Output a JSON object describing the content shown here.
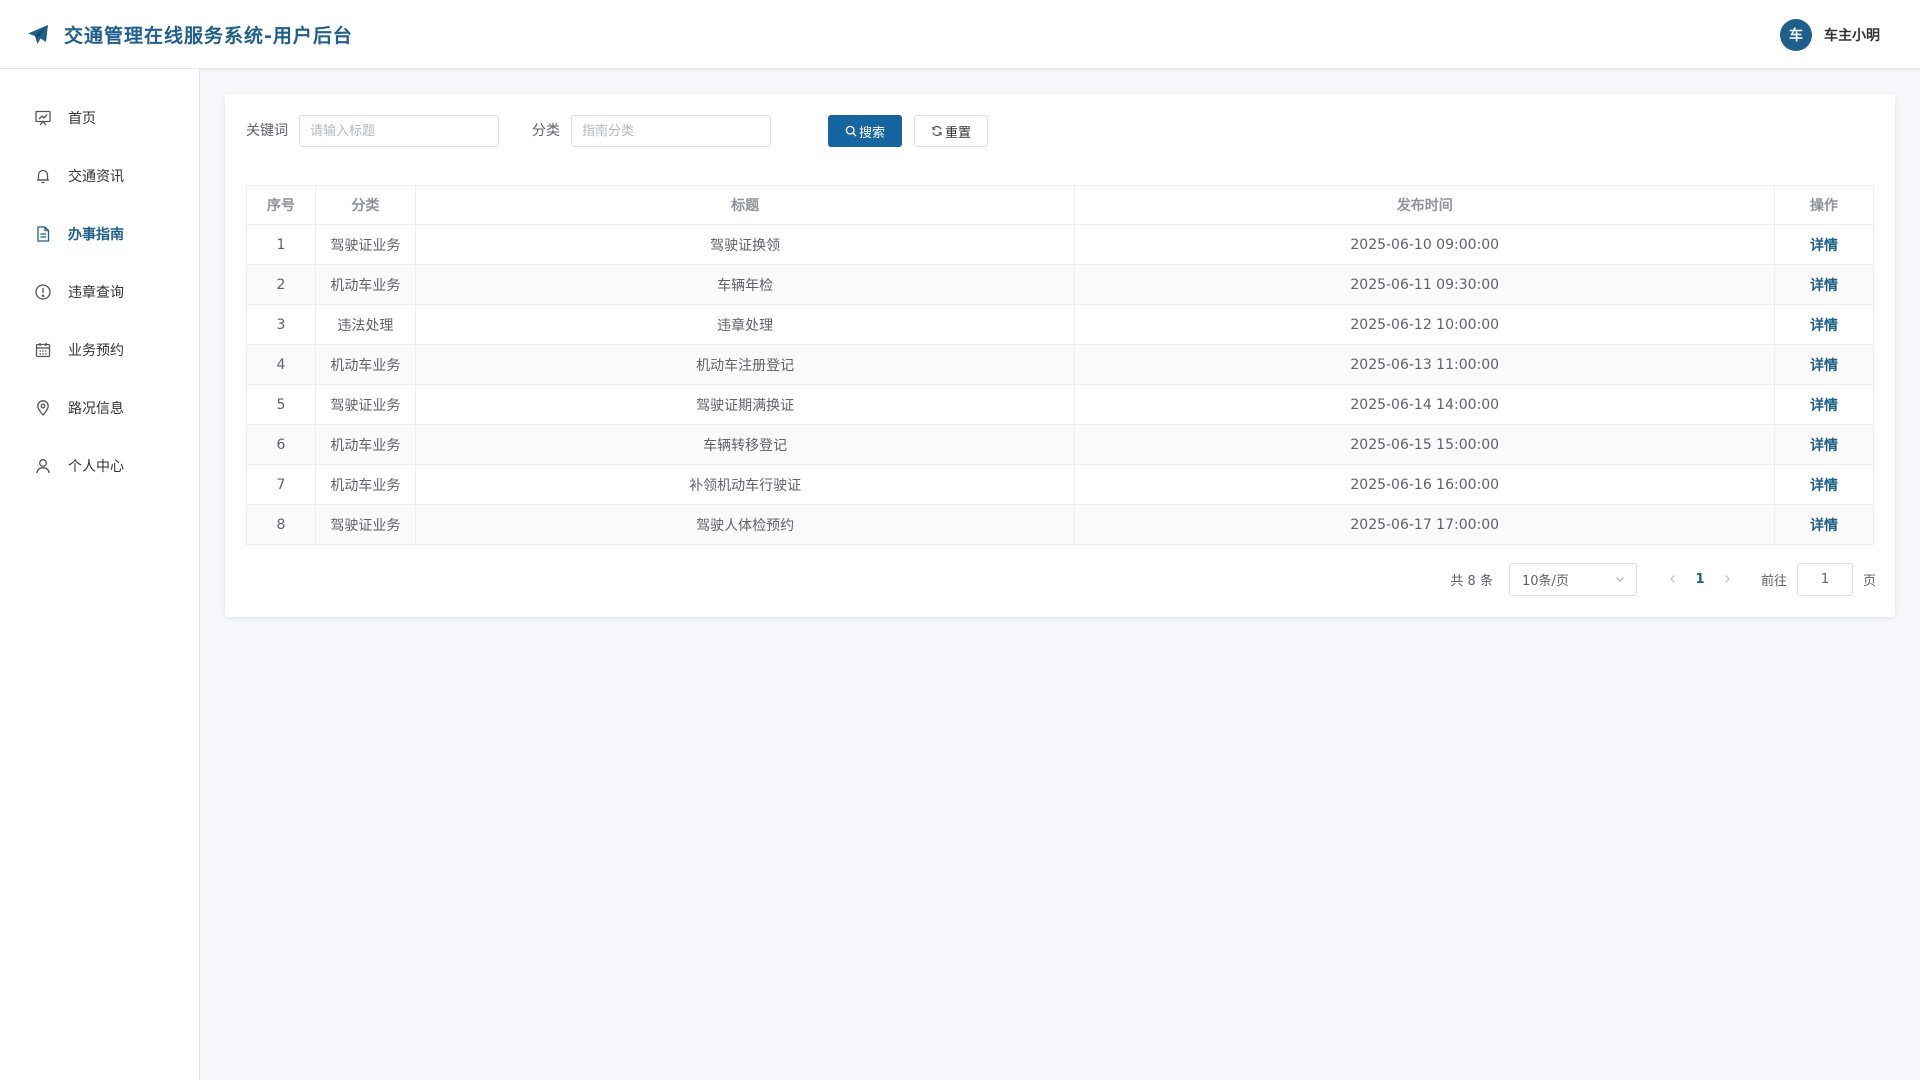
{
  "app": {
    "title": "交通管理在线服务系统-用户后台",
    "brand_color": "#1f5f8b"
  },
  "user": {
    "avatar_text": "车",
    "name": "车主小明"
  },
  "sidebar": {
    "items": [
      {
        "label": "首页",
        "icon": "dashboard-icon",
        "active": false
      },
      {
        "label": "交通资讯",
        "icon": "bell-icon",
        "active": false
      },
      {
        "label": "办事指南",
        "icon": "document-icon",
        "active": true
      },
      {
        "label": "违章查询",
        "icon": "warning-circle-icon",
        "active": false
      },
      {
        "label": "业务预约",
        "icon": "calendar-icon",
        "active": false
      },
      {
        "label": "路况信息",
        "icon": "location-pin-icon",
        "active": false
      },
      {
        "label": "个人中心",
        "icon": "user-icon",
        "active": false
      }
    ]
  },
  "filter": {
    "keyword_label": "关键词",
    "keyword_placeholder": "请输入标题",
    "keyword_value": "",
    "category_label": "分类",
    "category_placeholder": "指南分类",
    "category_value": "",
    "search_label": "搜索",
    "reset_label": "重置"
  },
  "table": {
    "headers": [
      "序号",
      "分类",
      "标题",
      "发布时间",
      "操作"
    ],
    "rows": [
      {
        "no": "1",
        "category": "驾驶证业务",
        "title": "驾驶证换领",
        "time": "2025-06-10 09:00:00",
        "action": "详情"
      },
      {
        "no": "2",
        "category": "机动车业务",
        "title": "车辆年检",
        "time": "2025-06-11 09:30:00",
        "action": "详情"
      },
      {
        "no": "3",
        "category": "违法处理",
        "title": "违章处理",
        "time": "2025-06-12 10:00:00",
        "action": "详情"
      },
      {
        "no": "4",
        "category": "机动车业务",
        "title": "机动车注册登记",
        "time": "2025-06-13 11:00:00",
        "action": "详情"
      },
      {
        "no": "5",
        "category": "驾驶证业务",
        "title": "驾驶证期满换证",
        "time": "2025-06-14 14:00:00",
        "action": "详情"
      },
      {
        "no": "6",
        "category": "机动车业务",
        "title": "车辆转移登记",
        "time": "2025-06-15 15:00:00",
        "action": "详情"
      },
      {
        "no": "7",
        "category": "机动车业务",
        "title": "补领机动车行驶证",
        "time": "2025-06-16 16:00:00",
        "action": "详情"
      },
      {
        "no": "8",
        "category": "驾驶证业务",
        "title": "驾驶人体检预约",
        "time": "2025-06-17 17:00:00",
        "action": "详情"
      }
    ]
  },
  "pagination": {
    "total_text": "共 8 条",
    "page_size": "10条/页",
    "current_page": "1",
    "goto_label": "前往",
    "goto_value": "1",
    "page_unit": "页"
  }
}
